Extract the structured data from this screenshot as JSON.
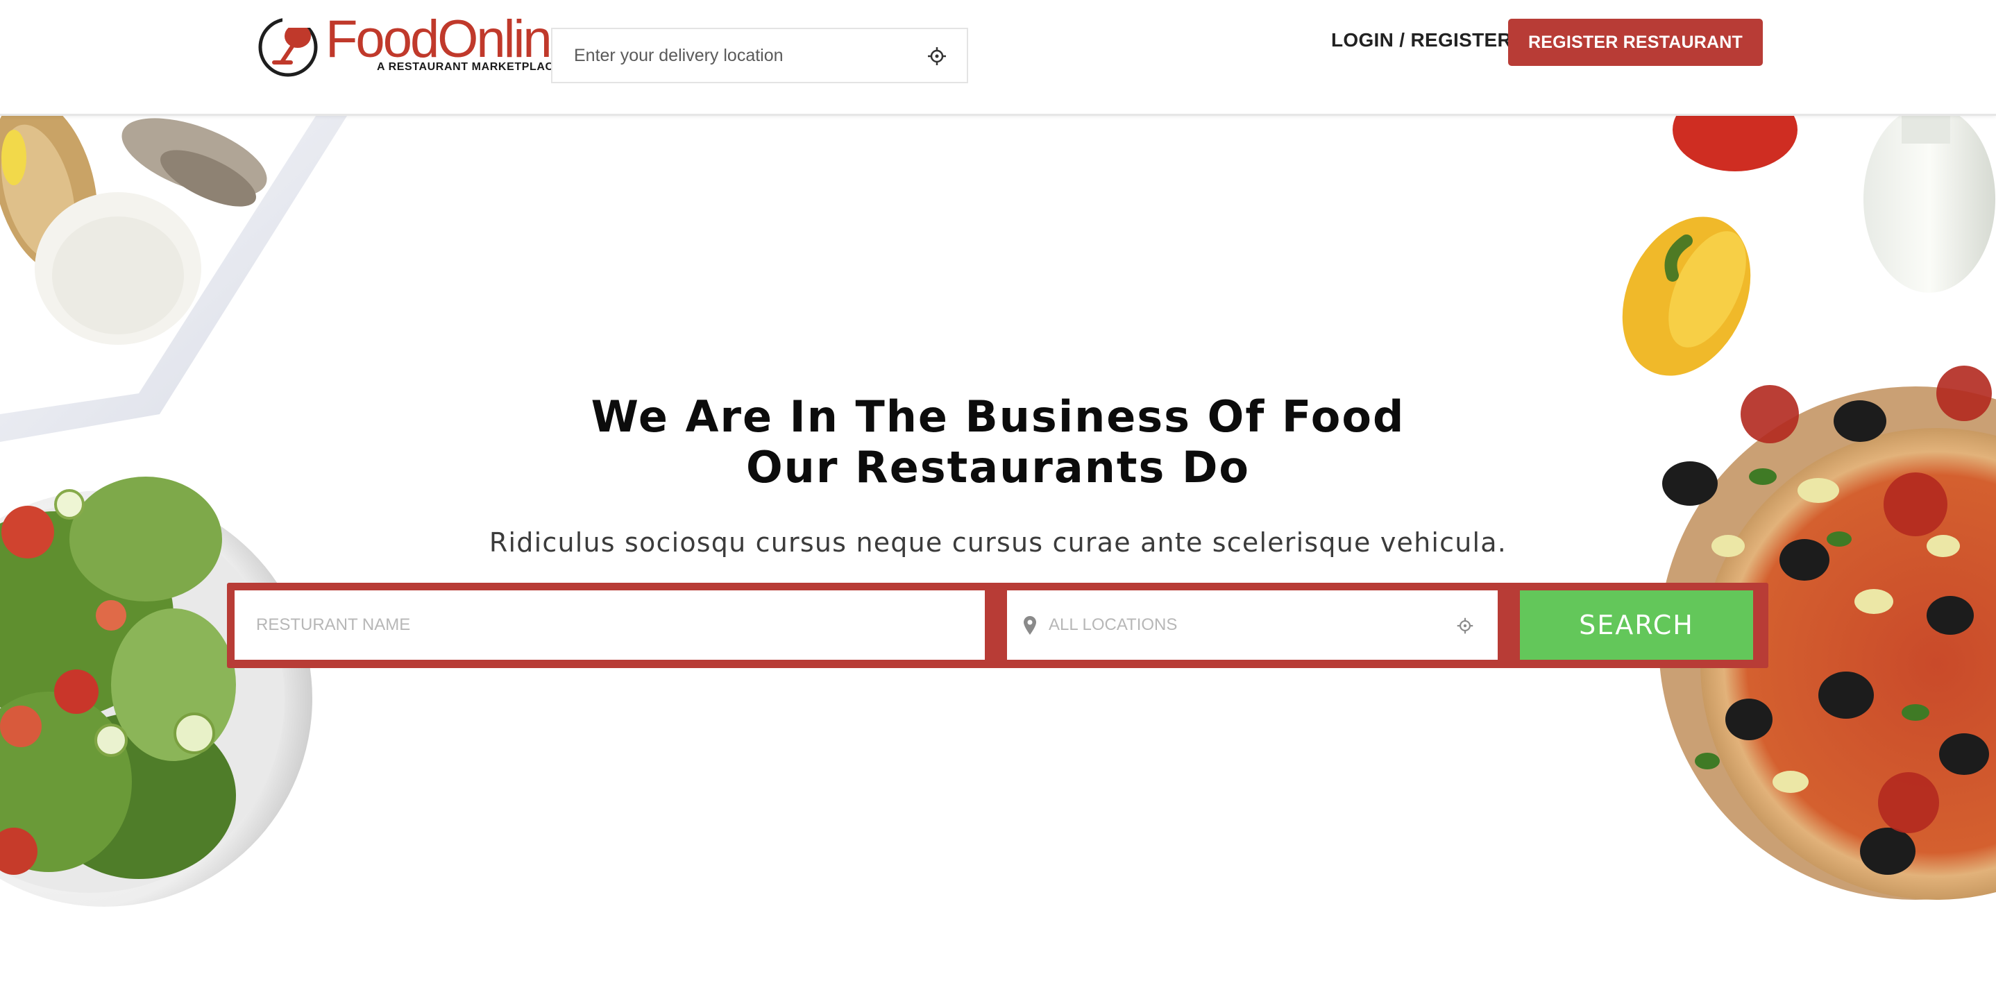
{
  "brand": {
    "name": "FoodOnline",
    "tagline": "A RESTAURANT MARKETPLACE",
    "color": "#c0392b"
  },
  "header": {
    "delivery_placeholder": "Enter your delivery location",
    "login_label": "LOGIN",
    "separator": "/",
    "register_label": "REGISTER",
    "register_restaurant_label": "REGISTER RESTAURANT"
  },
  "hero": {
    "title_line1": "We Are In The Business Of Food",
    "title_line2": "Our Restaurants Do",
    "subtitle": "Ridiculus sociosqu cursus neque cursus curae ante scelerisque vehicula."
  },
  "search": {
    "name_placeholder": "RESTURANT NAME",
    "location_placeholder": "ALL LOCATIONS",
    "button_label": "SEARCH"
  },
  "colors": {
    "accent_red": "#b83c36",
    "search_green": "#63c75a",
    "text_dark": "#0c0c0c"
  },
  "icons": {
    "locate": "crosshair-icon",
    "location_pin": "map-pin-icon",
    "logo_mark": "wine-glass-logo-icon"
  }
}
